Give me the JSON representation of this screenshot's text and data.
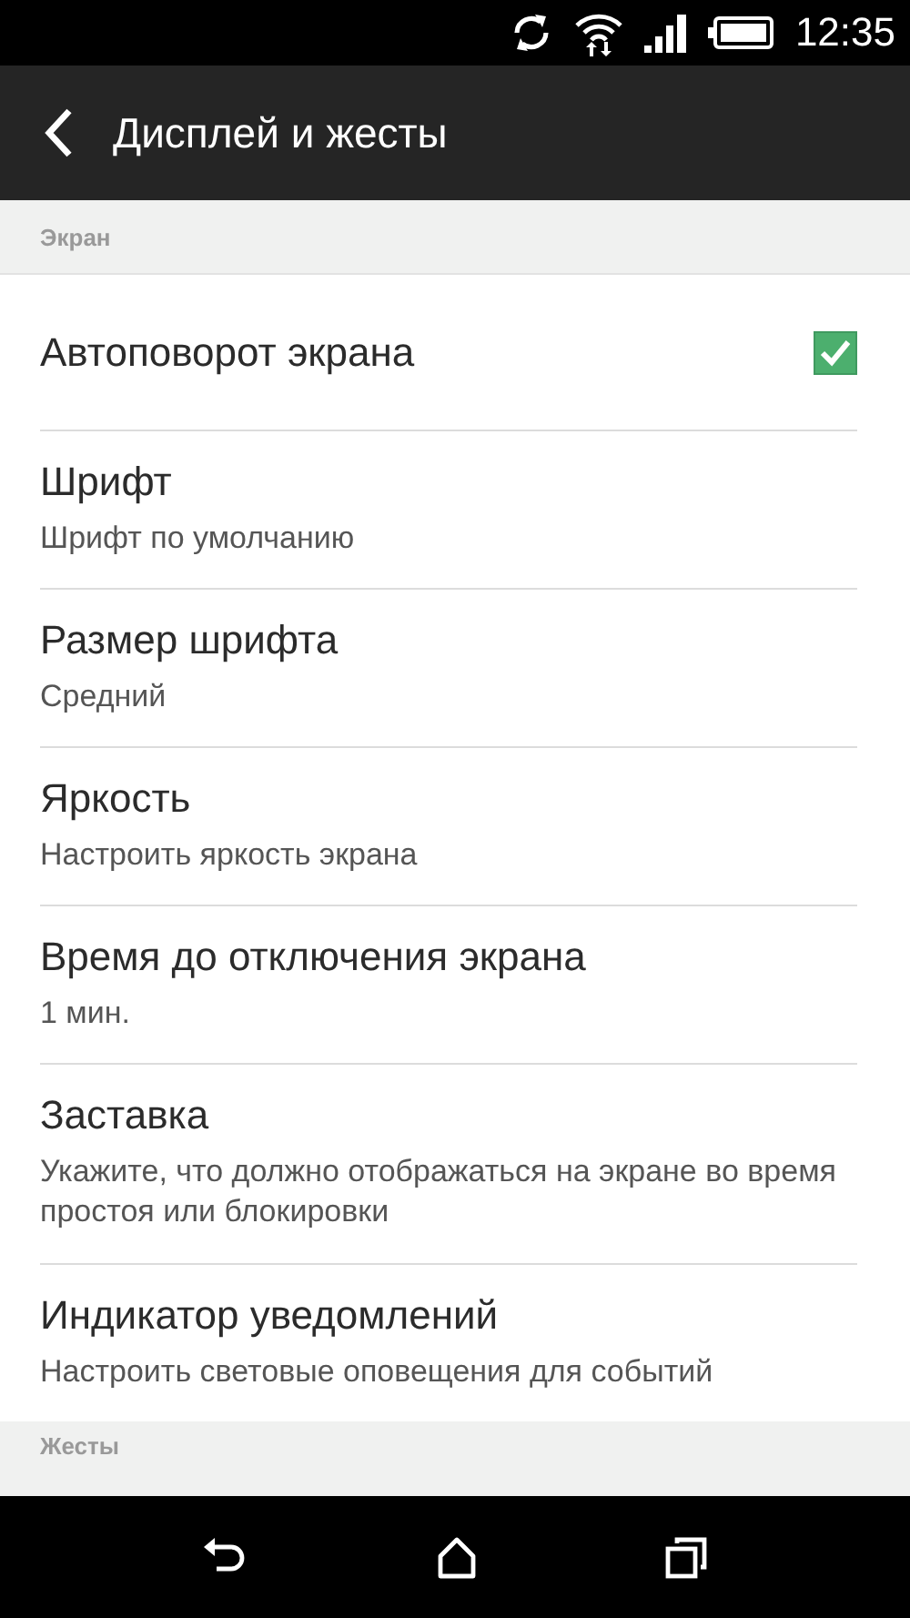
{
  "status_bar": {
    "time": "12:35"
  },
  "app_bar": {
    "title": "Дисплей и жесты"
  },
  "sections": [
    {
      "header": "Экран",
      "items": [
        {
          "kind": "checkbox",
          "title": "Автоповорот экрана",
          "checked": true
        },
        {
          "kind": "text",
          "title": "Шрифт",
          "summary": "Шрифт по умолчанию"
        },
        {
          "kind": "text",
          "title": "Размер шрифта",
          "summary": "Средний"
        },
        {
          "kind": "text",
          "title": "Яркость",
          "summary": "Настроить яркость экрана"
        },
        {
          "kind": "text",
          "title": "Время до отключения экрана",
          "summary": "1 мин."
        },
        {
          "kind": "text",
          "title": "Заставка",
          "summary": "Укажите, что должно отображаться на экране во время простоя или блокировки"
        },
        {
          "kind": "text",
          "title": "Индикатор уведомлений",
          "summary": "Настроить световые оповещения для событий"
        }
      ]
    },
    {
      "header": "Жесты"
    }
  ]
}
